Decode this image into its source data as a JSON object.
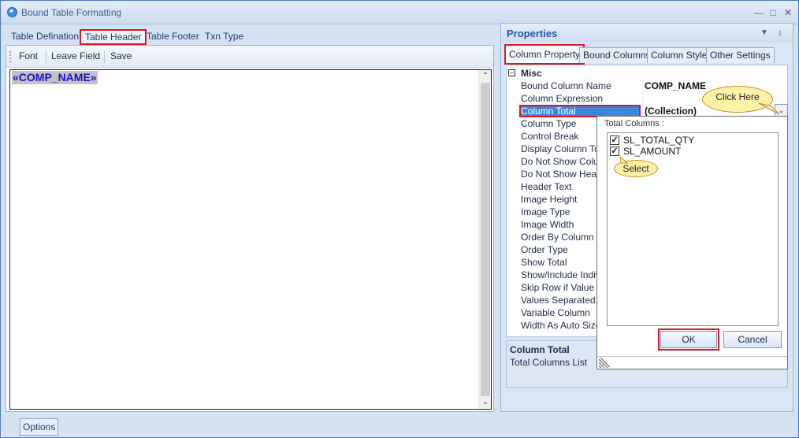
{
  "window": {
    "title": "Bound Table Formatting"
  },
  "left_tabs": [
    {
      "label": "Table Defination",
      "active": false
    },
    {
      "label": "Table Header",
      "active": true
    },
    {
      "label": "Table Footer",
      "active": false
    },
    {
      "label": "Txn Type",
      "active": false
    }
  ],
  "toolbar": {
    "font": "Font",
    "leave_field": "Leave Field",
    "save": "Save"
  },
  "editor": {
    "field_tag": "«COMP_NAME»"
  },
  "bottom": {
    "options": "Options"
  },
  "properties": {
    "title": "Properties",
    "tabs": [
      {
        "label": "Column Property",
        "active": true
      },
      {
        "label": "Bound Columns",
        "active": false
      },
      {
        "label": "Column Style",
        "active": false
      },
      {
        "label": "Other Settings",
        "active": false
      }
    ],
    "category": "Misc",
    "rows": [
      {
        "name": "Bound Column Name",
        "value": "COMP_NAME"
      },
      {
        "name": "Column Expression",
        "value": ""
      },
      {
        "name": "Column Total",
        "value": "(Collection)",
        "selected": true
      },
      {
        "name": "Column Type",
        "value": ""
      },
      {
        "name": "Control Break",
        "value": ""
      },
      {
        "name": "Display Column Total",
        "value": ""
      },
      {
        "name": "Do Not Show Column",
        "value": ""
      },
      {
        "name": "Do Not Show Header",
        "value": ""
      },
      {
        "name": "Header Text",
        "value": ""
      },
      {
        "name": "Image Height",
        "value": ""
      },
      {
        "name": "Image Type",
        "value": ""
      },
      {
        "name": "Image Width",
        "value": ""
      },
      {
        "name": "Order By Column Name",
        "value": ""
      },
      {
        "name": "Order Type",
        "value": ""
      },
      {
        "name": "Show Total",
        "value": ""
      },
      {
        "name": "Show/Include Individual",
        "value": ""
      },
      {
        "name": "Skip Row if Value is",
        "value": ""
      },
      {
        "name": "Values Separated By",
        "value": ""
      },
      {
        "name": "Variable Column",
        "value": ""
      },
      {
        "name": "Width As Auto Size",
        "value": ""
      }
    ],
    "description": {
      "title": "Column Total",
      "text": "Total Columns List"
    }
  },
  "popup": {
    "label": "Total Columns :",
    "items": [
      {
        "label": "SL_TOTAL_QTY",
        "checked": true
      },
      {
        "label": "SL_AMOUNT",
        "checked": true
      }
    ],
    "ok": "OK",
    "cancel": "Cancel"
  },
  "callouts": {
    "click_here": "Click Here",
    "select": "Select"
  },
  "colors": {
    "highlight_red": "#d31c24",
    "selection_blue": "#3d86e0",
    "callout_fill": "#fdf3a8"
  }
}
